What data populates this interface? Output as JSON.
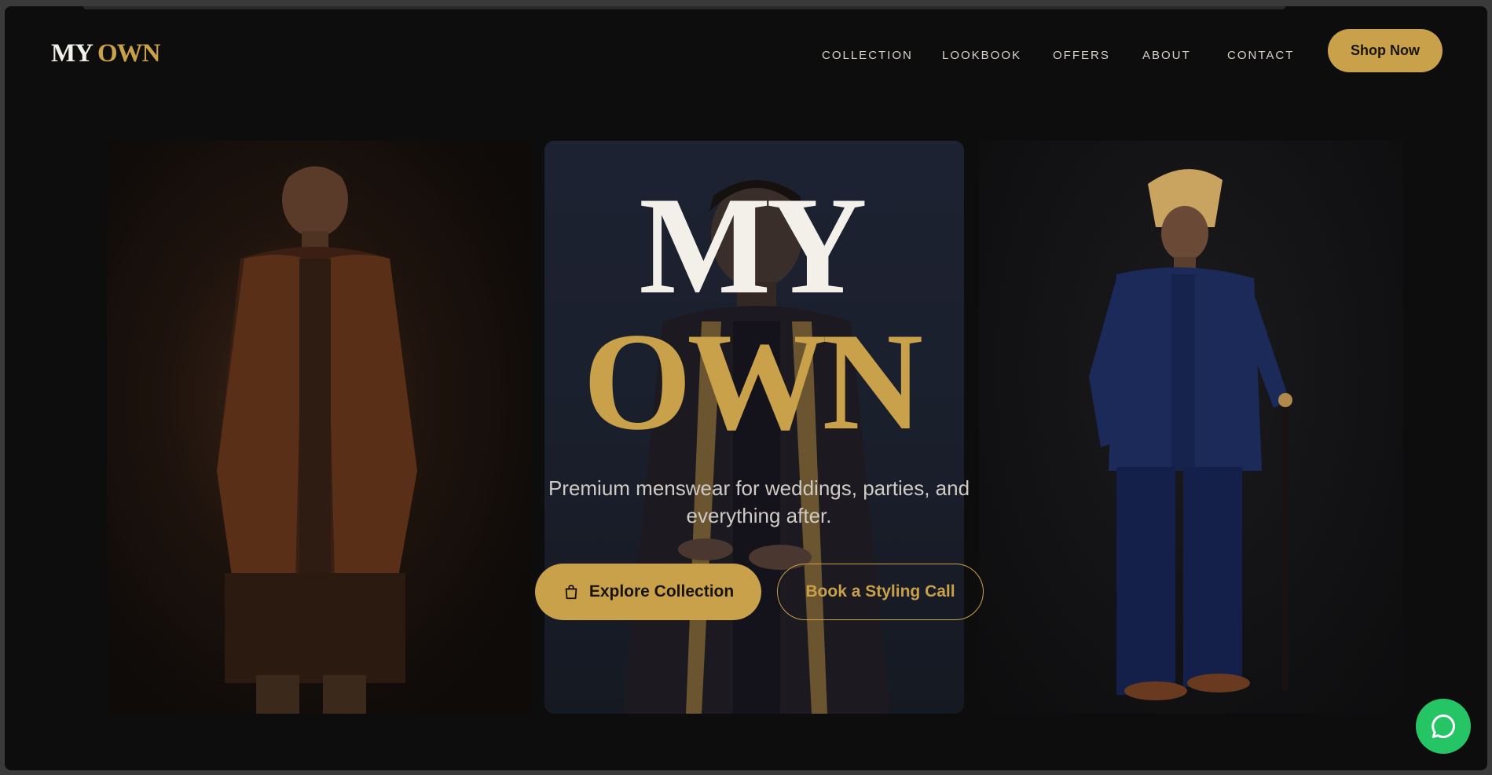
{
  "brand": {
    "word1": "MY",
    "word2": "OWN"
  },
  "nav": {
    "items": [
      {
        "label": "COLLECTION"
      },
      {
        "label": "LOOKBOOK"
      },
      {
        "label": "OFFERS"
      },
      {
        "label": "ABOUT"
      },
      {
        "label": "CONTACT"
      }
    ],
    "cta_label": "Shop Now"
  },
  "hero": {
    "title_line1": "MY",
    "title_line2": "OWN",
    "tagline": "Premium menswear for weddings, parties, and everything after.",
    "primary_button": "Explore Collection",
    "secondary_button": "Book a Styling Call"
  },
  "colors": {
    "gold": "#c9a14a",
    "background": "#0d0d0d",
    "cream": "#f3f0ea",
    "whatsapp_green": "#25c566"
  },
  "icons": {
    "primary_button_icon": "shopping-bag-icon",
    "chat_icon": "chat-bubble-icon"
  }
}
